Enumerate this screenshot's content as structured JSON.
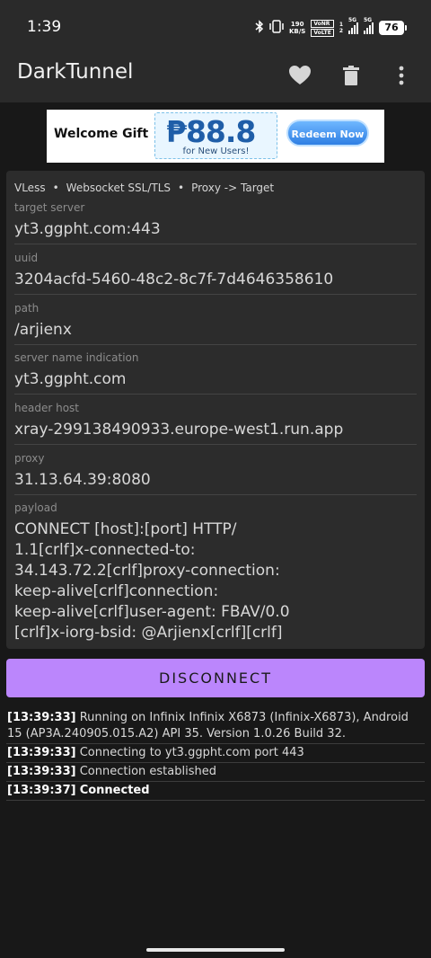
{
  "status_bar": {
    "time": "1:39",
    "speed_value": "190",
    "speed_unit": "KB/S",
    "volte_1": "VoNR",
    "volte_2": "VoLTE",
    "sim1_label": "1",
    "sim2_label": "2",
    "net1": "5G",
    "net2": "5G",
    "battery": "76",
    "icons": [
      "bluetooth-icon",
      "vibrate-icon",
      "signal-icon",
      "battery-icon"
    ]
  },
  "app_bar": {
    "title": "DarkTunnel",
    "actions": [
      "heart-icon",
      "trash-icon",
      "more-vert-icon"
    ]
  },
  "ad": {
    "title": "Welcome Gift",
    "amount": "₱88.8",
    "subtitle": "for New Users!",
    "button": "Redeem Now"
  },
  "config": {
    "protocol": "VLess",
    "transport": "Websocket SSL/TLS",
    "mode": "Proxy -> Target",
    "separator": "•",
    "fields": [
      {
        "label": "target server",
        "value": "yt3.ggpht.com:443"
      },
      {
        "label": "uuid",
        "value": "3204acfd-5460-48c2-8c7f-7d4646358610"
      },
      {
        "label": "path",
        "value": "/arjienx"
      },
      {
        "label": "server name indication",
        "value": "yt3.ggpht.com"
      },
      {
        "label": "header host",
        "value": "xray-299138490933.europe-west1.run.app"
      },
      {
        "label": "proxy",
        "value": "31.13.64.39:8080"
      }
    ],
    "payload": {
      "label": "payload",
      "lines": [
        "CONNECT [host]:[port] HTTP/",
        "1.1[crlf]x-connected-to:",
        "34.143.72.2[crlf]proxy-connection:",
        "keep-alive[crlf]connection:",
        "keep-alive[crlf]user-agent: FBAV/0.0",
        "[crlf]x-iorg-bsid: @Arjienx[crlf][crlf]"
      ]
    }
  },
  "disconnect_label": "DISCONNECT",
  "log": [
    {
      "ts": "[13:39:33]",
      "msg": "Running on Infinix Infinix X6873 (Infinix-X6873), Android 15 (AP3A.240905.015.A2) API 35. Version 1.0.26 Build 32.",
      "bold": false
    },
    {
      "ts": "[13:39:33]",
      "msg": "Connecting to yt3.ggpht.com port 443",
      "bold": false
    },
    {
      "ts": "[13:39:33]",
      "msg": "Connection established",
      "bold": false
    },
    {
      "ts": "[13:39:37]",
      "msg": "Connected",
      "bold": true
    }
  ],
  "colors": {
    "accent": "#bb86fc",
    "background": "#181818",
    "surface": "#2c2c2c",
    "app_bar": "#2a2a2a"
  }
}
